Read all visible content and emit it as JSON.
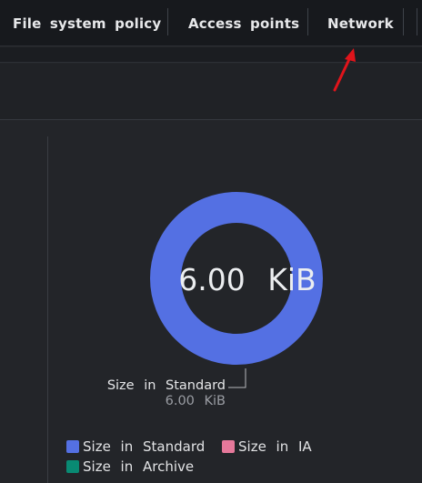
{
  "tabs": [
    {
      "label": "File system policy"
    },
    {
      "label": "Access points"
    },
    {
      "label": "Network"
    }
  ],
  "colors": {
    "standard": "#5470e3",
    "ia": "#e5789a",
    "archive": "#098a73",
    "annotation_arrow": "#e0141b"
  },
  "chart_data": {
    "type": "pie",
    "center_label": "6.00 KiB",
    "slices": [
      {
        "name": "Size in Standard",
        "value": 6.0,
        "unit": "KiB",
        "value_label": "6.00 KiB"
      }
    ],
    "legend": [
      "Size in Standard",
      "Size in IA",
      "Size in Archive"
    ],
    "legend_placement": "bottom-left"
  }
}
